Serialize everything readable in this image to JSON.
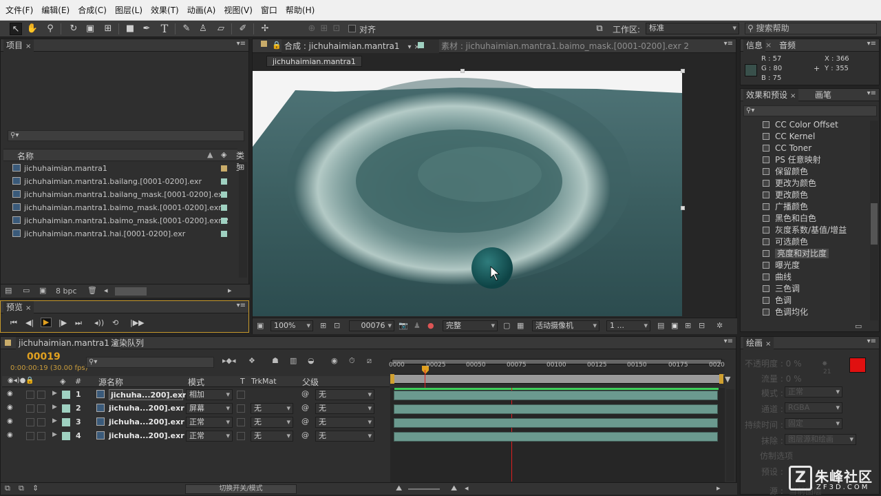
{
  "menu": [
    "文件(F)",
    "编辑(E)",
    "合成(C)",
    "图层(L)",
    "效果(T)",
    "动画(A)",
    "视图(V)",
    "窗口",
    "帮助(H)"
  ],
  "toolbar": {
    "align_label": "对齐",
    "workspace_label": "工作区:",
    "workspace_value": "标准",
    "search_help": "搜索帮助"
  },
  "project": {
    "tab": "项目",
    "col_name": "名称",
    "col_type": "类型",
    "items": [
      {
        "name": "jichuhaimian.mantra1",
        "color": "#c9ac6a"
      },
      {
        "name": "jichuhaimian.mantra1.bailang.[0001-0200].exr",
        "color": "#9fd1c1"
      },
      {
        "name": "jichuhaimian.mantra1.bailang_mask.[0001-0200].exr",
        "color": "#9fd1c1"
      },
      {
        "name": "jichuhaimian.mantra1.baimo_mask.[0001-0200].exr",
        "color": "#9fd1c1"
      },
      {
        "name": "jichuhaimian.mantra1.baimo_mask.[0001-0200].exr 2",
        "color": "#9fd1c1"
      },
      {
        "name": "jichuhaimian.mantra1.hai.[0001-0200].exr",
        "color": "#9fd1c1"
      }
    ],
    "bpc": "8 bpc"
  },
  "preview": {
    "tab": "预览"
  },
  "comp": {
    "tab": "合成 : jichuhaimian.mantra1",
    "footage_tab": "素材 : jichuhaimian.mantra1.baimo_mask.[0001-0200].exr 2",
    "subtab": "jichuhaimian.mantra1",
    "zoom": "100%",
    "frame": "00076",
    "quality": "完整",
    "camera": "活动摄像机",
    "views": "1 ..."
  },
  "info": {
    "tab": "信息",
    "audio_tab": "音频",
    "r": "R : 57",
    "g": "G : 80",
    "b": "B : 75",
    "x": "X : 366",
    "y": "Y : 355"
  },
  "effects": {
    "tab": "效果和预设",
    "brush_tab": "画笔",
    "items": [
      "CC Color Offset",
      "CC Kernel",
      "CC Toner",
      "PS 任意映射",
      "保留颜色",
      "更改为颜色",
      "更改颜色",
      "广播颜色",
      "黑色和白色",
      "灰度系数/基值/增益",
      "可选颜色",
      "亮度和对比度",
      "曝光度",
      "曲线",
      "三色调",
      "色调",
      "色调均化"
    ],
    "selected_index": 11
  },
  "timeline": {
    "tab": "jichuhaimian.mantra1",
    "render_tab": "渲染队列",
    "timecode": "00019",
    "fps": "0:00:00:19 (30.00 fps)",
    "headers": {
      "source": "源名称",
      "mode": "模式",
      "t": "T",
      "trkmat": "TrkMat",
      "parent": "父级"
    },
    "ruler": [
      "0000",
      "00025",
      "00050",
      "00075",
      "00100",
      "00125",
      "00150",
      "00175",
      "0020"
    ],
    "layers": [
      {
        "num": "1",
        "name": "jichuha...200].exr",
        "mode": "相加",
        "trkmat": "",
        "parent": "无"
      },
      {
        "num": "2",
        "name": "jichuha...200].exr",
        "mode": "屏幕",
        "trkmat": "无",
        "parent": "无"
      },
      {
        "num": "3",
        "name": "jichuha...200].exr",
        "mode": "正常",
        "trkmat": "无",
        "parent": "无"
      },
      {
        "num": "4",
        "name": "jichuha...200].exr",
        "mode": "正常",
        "trkmat": "无",
        "parent": "无"
      }
    ],
    "toggle_label": "切换开关/模式"
  },
  "paint": {
    "tab": "绘画",
    "opacity": "不透明度 : 0 %",
    "flow": "流量 : 0 %",
    "mode_label": "模式 :",
    "mode_value": "正常",
    "channel_label": "通道 :",
    "channel_value": "RGBA",
    "duration_label": "持续时间 :",
    "duration_value": "固定",
    "erase_label": "抹除 :",
    "erase_value": "图层源和绘画",
    "clone_label": "仿制选项",
    "preset_label": "预设 :",
    "source_label": "源 :",
    "source_value": "当前图层",
    "brush_size": "21"
  },
  "watermark": {
    "cn": "朱峰社区",
    "en": "ZF3D.COM"
  }
}
